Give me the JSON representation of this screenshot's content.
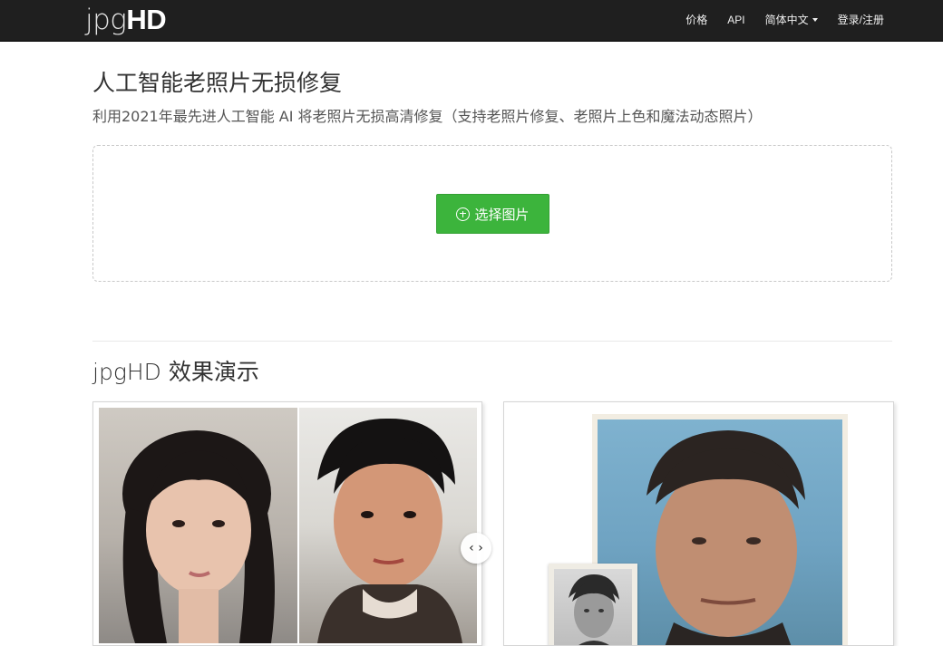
{
  "navbar": {
    "logo_light": "jpg",
    "logo_bold": "HD",
    "links": [
      "价格",
      "API",
      "简体中文",
      "登录/注册"
    ]
  },
  "hero": {
    "title": "人工智能老照片无损修复",
    "subtitle": "利用2021年最先进人工智能 AI 将老照片无损高清修复（支持老照片修复、老照片上色和魔法动态照片）",
    "upload_button": "选择图片"
  },
  "demo": {
    "title": "jpgHD 效果演示",
    "arrow_glyph": "‹ ›"
  },
  "colors": {
    "navbar_bg": "#1f1f1f",
    "accent_green": "#3cb43c"
  }
}
